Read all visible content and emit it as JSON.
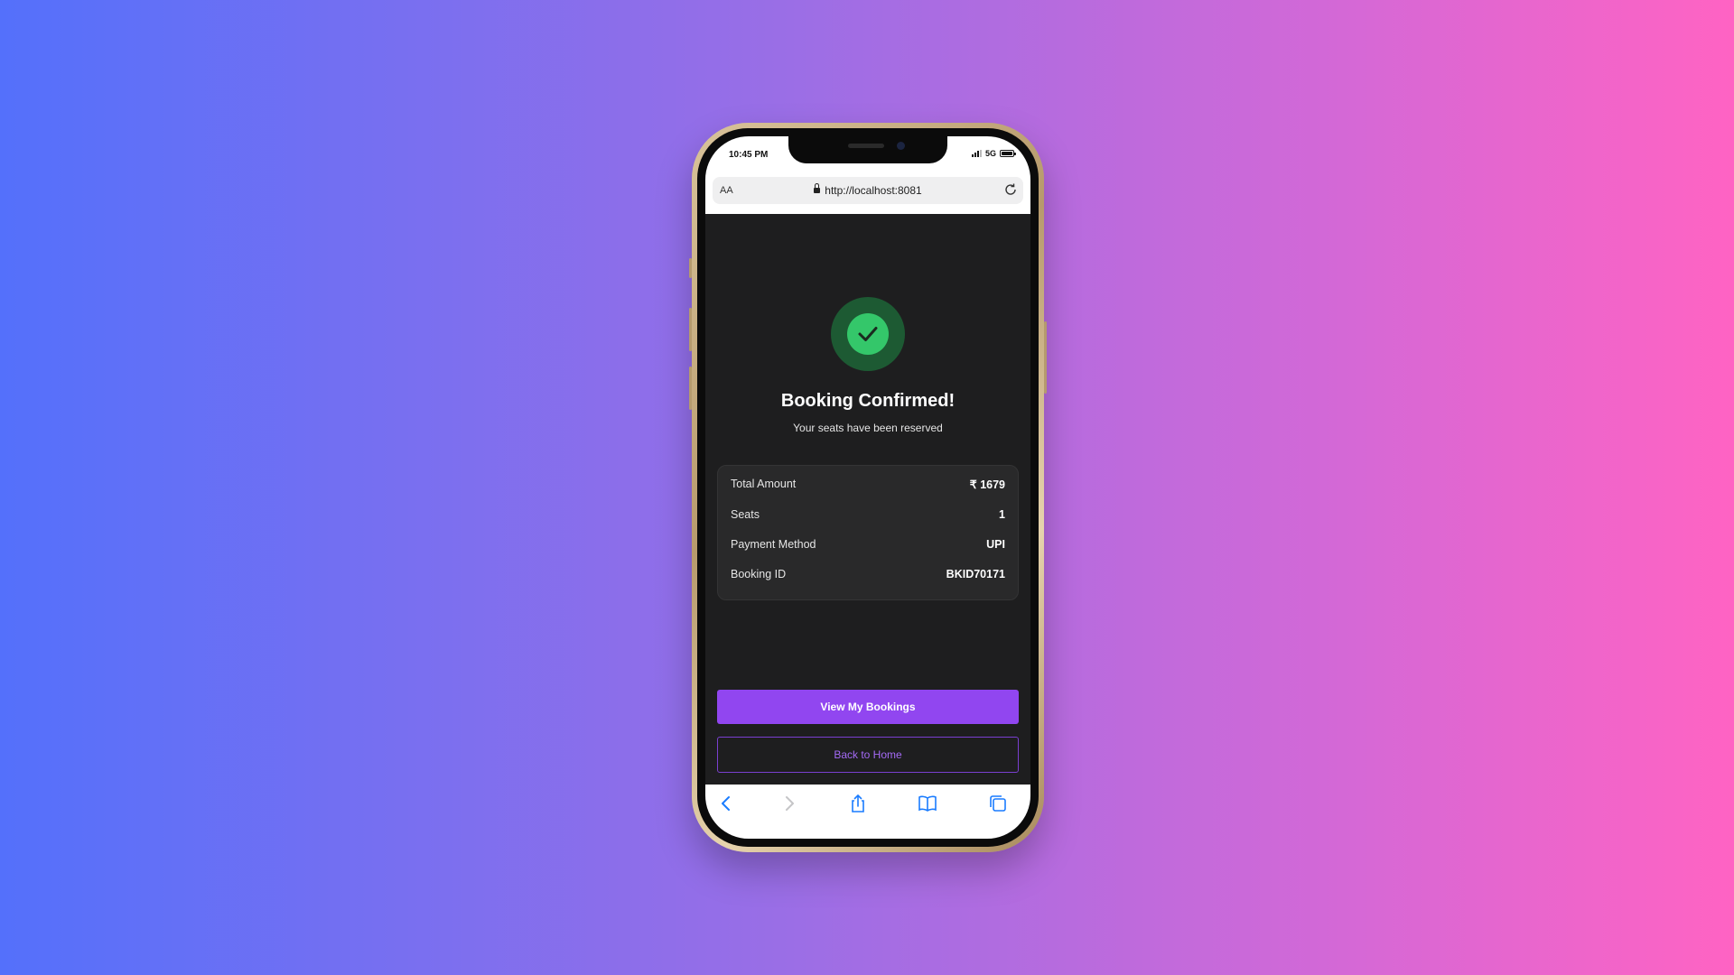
{
  "status_bar": {
    "time": "10:45 PM",
    "network": "5G"
  },
  "browser": {
    "text_size_label": "AA",
    "url": "http://localhost:8081"
  },
  "confirmation": {
    "title": "Booking Confirmed!",
    "subtitle": "Your seats have been reserved"
  },
  "summary": {
    "rows": [
      {
        "label": "Total Amount",
        "value": "₹ 1679"
      },
      {
        "label": "Seats",
        "value": "1"
      },
      {
        "label": "Payment Method",
        "value": "UPI"
      },
      {
        "label": "Booking ID",
        "value": "BKID70171"
      }
    ]
  },
  "actions": {
    "primary_label": "View My Bookings",
    "secondary_label": "Back to Home"
  },
  "colors": {
    "accent": "#9146f0",
    "success": "#34c76a",
    "screen_bg": "#1e1e1f",
    "ios_blue": "#1a7cff"
  },
  "icons": {
    "toolbar": [
      "back-icon",
      "forward-icon",
      "share-icon",
      "bookmarks-icon",
      "tabs-icon"
    ]
  }
}
